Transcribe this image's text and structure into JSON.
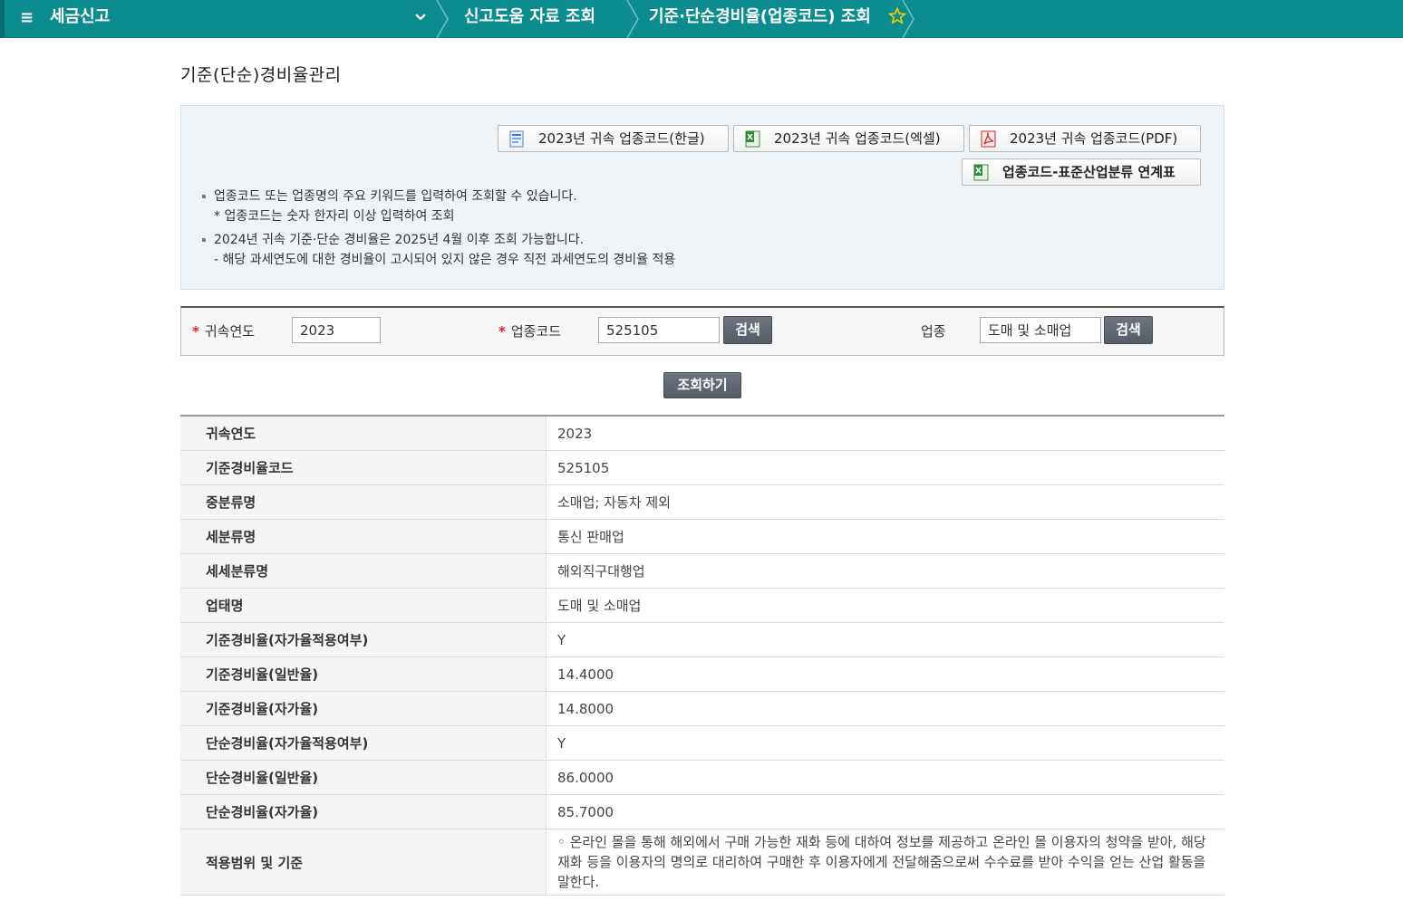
{
  "nav": {
    "home": "세금신고",
    "crumb2": "신고도움 자료 조회",
    "crumb3": "기준·단순경비율(업종코드) 조회"
  },
  "page": {
    "title": "기준(단순)경비율관리"
  },
  "downloads": {
    "hwp": "2023년 귀속 업종코드(한글)",
    "xls": "2023년 귀속 업종코드(엑셀)",
    "pdf": "2023년 귀속 업종코드(PDF)",
    "mapping": "업종코드-표준산업분류 연계표"
  },
  "notes": {
    "line1": "업종코드 또는 업종명의 주요 키워드를 입력하여 조회할 수 있습니다.",
    "line1_sub": "* 업종코드는 숫자 한자리 이상 입력하여 조회",
    "line2": "2024년 귀속 기준·단순 경비율은 2025년 4월 이후 조회 가능합니다.",
    "line2_sub": "- 해당 과세연도에 대한 경비율이 고시되어 있지 않은 경우 직전 과세연도의 경비율 적용"
  },
  "search": {
    "required_mark": "*",
    "year_label": "귀속연도",
    "year_value": "2023",
    "code_label": "업종코드",
    "code_value": "525105",
    "biz_label": "업종",
    "biz_value": "도매 및 소매업",
    "search_btn": "검색",
    "query_btn": "조회하기"
  },
  "result": {
    "rows": [
      {
        "label": "귀속연도",
        "value": "2023"
      },
      {
        "label": "기준경비율코드",
        "value": "525105"
      },
      {
        "label": "중분류명",
        "value": "소매업; 자동차 제외"
      },
      {
        "label": "세분류명",
        "value": "통신 판매업"
      },
      {
        "label": "세세분류명",
        "value": "해외직구대행업"
      },
      {
        "label": "업태명",
        "value": "도매 및 소매업"
      },
      {
        "label": "기준경비율(자가율적용여부)",
        "value": "Y"
      },
      {
        "label": "기준경비율(일반율)",
        "value": "14.4000"
      },
      {
        "label": "기준경비율(자가율)",
        "value": "14.8000"
      },
      {
        "label": "단순경비율(자가율적용여부)",
        "value": "Y"
      },
      {
        "label": "단순경비율(일반율)",
        "value": "86.0000"
      },
      {
        "label": "단순경비율(자가율)",
        "value": "85.7000"
      },
      {
        "label": "적용범위 및 기준",
        "value": "◦ 온라인 몰을 통해 해외에서 구매 가능한 재화 등에 대하여 정보를 제공하고 온라인 몰 이용자의 청약을 받아, 해당 재화 등을 이용자의 명의로 대리하여 구매한 후 이용자에게 전달해줌으로써 수수료를 받아 수익을 얻는 산업 활동을 말한다."
      }
    ]
  }
}
